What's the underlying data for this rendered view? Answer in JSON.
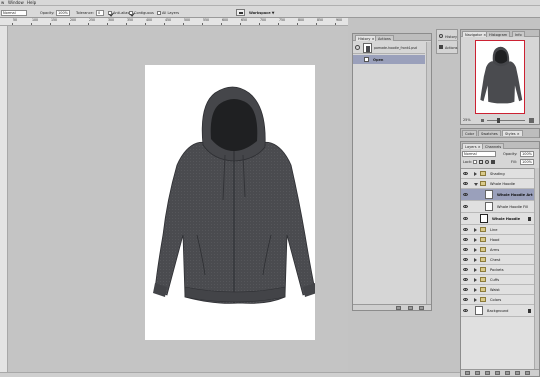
{
  "menubar": {
    "items": [
      "w",
      "Window",
      "Help"
    ]
  },
  "options_bar": {
    "mode_value": "Normal",
    "opacity_label": "Opacity:",
    "opacity_value": "100%",
    "tolerance_label": "Tolerance:",
    "tolerance_value": "0",
    "antialias_label": "Anti-alias",
    "contiguous_label": "Contiguous",
    "all_layers_label": "All Layers",
    "workspace_label": "Workspace ▼"
  },
  "ruler": {
    "ticks": [
      "50",
      "100",
      "150",
      "200",
      "250",
      "300",
      "350",
      "400",
      "450",
      "500",
      "550",
      "600",
      "650",
      "700",
      "750",
      "800",
      "850",
      "900"
    ]
  },
  "history_panel": {
    "tabs": [
      "History ×",
      "Actions"
    ],
    "snapshot_name": "pomade-hoodie_front4.psd",
    "state_label": "Open"
  },
  "collapsed_dock": {
    "items": [
      "History",
      "Actions"
    ]
  },
  "navigator_panel": {
    "tabs": [
      "Navigator ×",
      "Histogram",
      "Info"
    ],
    "zoom_value": "25%"
  },
  "styles_panel": {
    "tabs": [
      "Color",
      "Swatches",
      "Styles ×"
    ]
  },
  "layers_panel": {
    "tabs": [
      "Layers ×",
      "Channels"
    ],
    "blend_mode": "Normal",
    "opacity_label": "Opacity:",
    "opacity_value": "100%",
    "lock_label": "Lock:",
    "fill_label": "Fill:",
    "fill_value": "100%",
    "layers": [
      {
        "name": "Shading",
        "kind": "group",
        "open": false,
        "indent": 0
      },
      {
        "name": "Whole Hoodie",
        "kind": "group",
        "open": true,
        "indent": 0
      },
      {
        "name": "Whole Hoodie Art",
        "kind": "layer",
        "indent": 1,
        "highlight": true
      },
      {
        "name": "Whole Hoodie Fill",
        "kind": "layer",
        "indent": 1
      },
      {
        "name": "Whole Hoodie",
        "kind": "layer",
        "indent": 0,
        "outlined": true
      },
      {
        "name": "Line",
        "kind": "group",
        "open": false,
        "indent": 0
      },
      {
        "name": "Hood",
        "kind": "group",
        "open": false,
        "indent": 0
      },
      {
        "name": "Arms",
        "kind": "group",
        "open": false,
        "indent": 0
      },
      {
        "name": "Chest",
        "kind": "group",
        "open": false,
        "indent": 0
      },
      {
        "name": "Pockets",
        "kind": "group",
        "open": false,
        "indent": 0
      },
      {
        "name": "Cuffs",
        "kind": "group",
        "open": false,
        "indent": 0
      },
      {
        "name": "Waist",
        "kind": "group",
        "open": false,
        "indent": 0
      },
      {
        "name": "Colors",
        "kind": "group",
        "open": false,
        "indent": 0
      },
      {
        "name": "Background",
        "kind": "background",
        "indent": 0
      }
    ]
  },
  "colors": {
    "accent": "#cc2233",
    "selection": "#9aa0bb",
    "hoodie": "#4a4b4f",
    "canvas_bg": "#c4c4c4"
  }
}
